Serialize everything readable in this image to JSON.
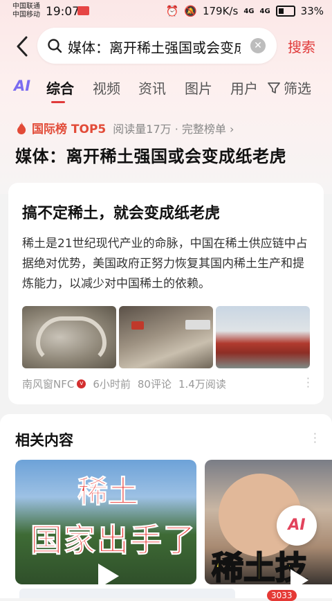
{
  "status_bar": {
    "carrier_1": "中国联通",
    "carrier_2": "中国移动",
    "time": "19:07",
    "network_speed": "179K/s",
    "signal_1": "4G",
    "signal_2": "4G",
    "battery": "33%"
  },
  "search": {
    "query": "媒体：离开稀土强国或会变成纸老虎",
    "button_label": "搜索"
  },
  "tabs": {
    "ai": "AI",
    "items": [
      "综合",
      "视频",
      "资讯",
      "图片",
      "用户"
    ],
    "active": "综合",
    "filter_label": "筛选"
  },
  "hot_list": {
    "label": "国际榜 TOP5",
    "meta": "阅读量17万 · 完整榜单 ›",
    "headline": "媒体：离开稀土强国或会变成纸老虎"
  },
  "article": {
    "title": "搞不定稀土，就会变成纸老虎",
    "body": "稀土是21世纪现代产业的命脉，中国在稀土供应链中占据绝对优势，美国政府正努力恢复其国内稀土生产和提炼能力，以减少对中国稀土的依赖。",
    "source": "南风窗NFC",
    "time_ago": "6小时前",
    "comments": "80评论",
    "reads": "1.4万阅读"
  },
  "related": {
    "title": "相关内容",
    "video1_line1": "稀土",
    "video1_line2": "国家出手了",
    "video2_caption": "稀土技"
  },
  "ai_fab": "AI",
  "bottom_badge": "3033",
  "colors": {
    "accent_red": "#e03a3a",
    "ai_purple": "#7b6cf0"
  }
}
